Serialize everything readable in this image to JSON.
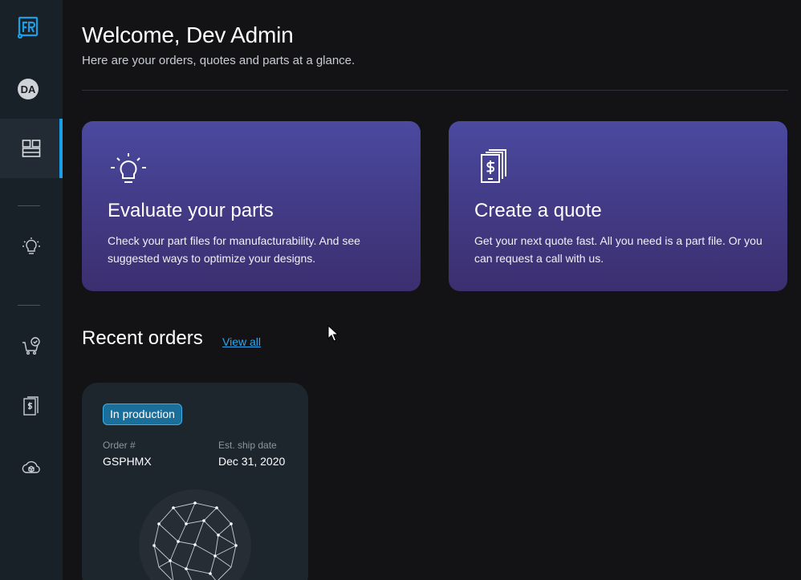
{
  "sidebar": {
    "logo": "fr-logo-icon",
    "avatar_initials": "DA",
    "items": [
      {
        "icon": "dashboard-icon",
        "active": true
      },
      {
        "icon": "lightbulb-icon",
        "active": false
      },
      {
        "icon": "cart-check-icon",
        "active": false
      },
      {
        "icon": "quote-dollar-icon",
        "active": false
      },
      {
        "icon": "cloud-box-icon",
        "active": false
      }
    ],
    "accent_color": "#1a9fe6"
  },
  "header": {
    "title": "Welcome, Dev Admin",
    "subtitle": "Here are your orders, quotes and parts at a glance."
  },
  "cards": [
    {
      "icon": "lightbulb-icon",
      "title": "Evaluate your parts",
      "description": "Check your part files for manufacturability. And see suggested ways to optimize your designs."
    },
    {
      "icon": "quote-dollar-icon",
      "title": "Create a quote",
      "description": "Get your next quote fast. All you need is a part file. Or you can request a call with us."
    }
  ],
  "recent_orders": {
    "title": "Recent orders",
    "view_all_label": "View all",
    "orders": [
      {
        "status": "In production",
        "order_label": "Order #",
        "order_number": "GSPHMX",
        "ship_label": "Est. ship date",
        "ship_date": "Dec 31, 2020",
        "thumbnail_icon": "wireframe-sphere-icon"
      }
    ]
  },
  "colors": {
    "background": "#131316",
    "sidebar": "#182028",
    "card_gradient_top": "#4b4aa0",
    "card_gradient_bottom": "#3c2f70",
    "link": "#2ea6ee",
    "badge": "#1a6f9a"
  }
}
